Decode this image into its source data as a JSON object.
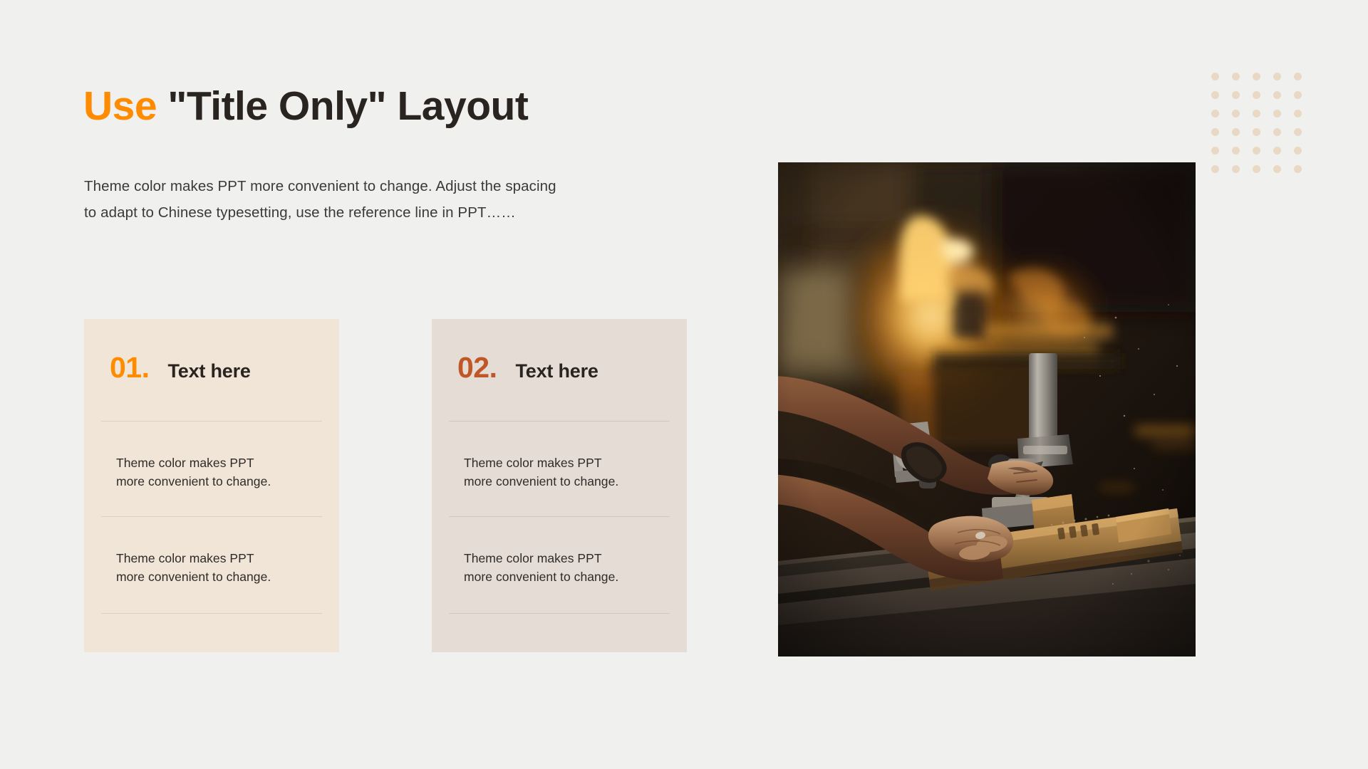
{
  "slide": {
    "background_color": "#F0F0EF",
    "accent_orange": "#FF8C00",
    "accent_rust": "#BF5726",
    "heading_color": "#2A2420"
  },
  "title": {
    "accent_word": "Use",
    "rest": " \"Title Only\" Layout"
  },
  "subtitle": {
    "line1": "Theme color makes PPT more convenient to change. Adjust the spacing",
    "line2": "to adapt to Chinese typesetting, use the reference line in PPT……"
  },
  "decoration": {
    "dot_grid": {
      "columns": 5,
      "rows": 6,
      "dot_color": "#E9D8C4"
    }
  },
  "cards": [
    {
      "number": "01.",
      "title": "Text here",
      "number_color": "#FF8C00",
      "background_color": "#F1E5D8",
      "items": [
        {
          "line1": "Theme  color makes PPT",
          "line2": "more convenient to change."
        },
        {
          "line1": "Theme  color makes PPT",
          "line2": "more convenient to change."
        }
      ]
    },
    {
      "number": "02.",
      "title": "Text here",
      "number_color": "#BF5726",
      "background_color": "#E6DCD6",
      "items": [
        {
          "line1": "Theme  color makes PPT",
          "line2": "more convenient to change."
        },
        {
          "line1": "Theme  color makes PPT",
          "line2": "more convenient to change."
        }
      ]
    }
  ],
  "photo": {
    "alt": "Woodworking workshop, hands guiding a board through a router on a table saw, warm amber lamp light in background"
  }
}
